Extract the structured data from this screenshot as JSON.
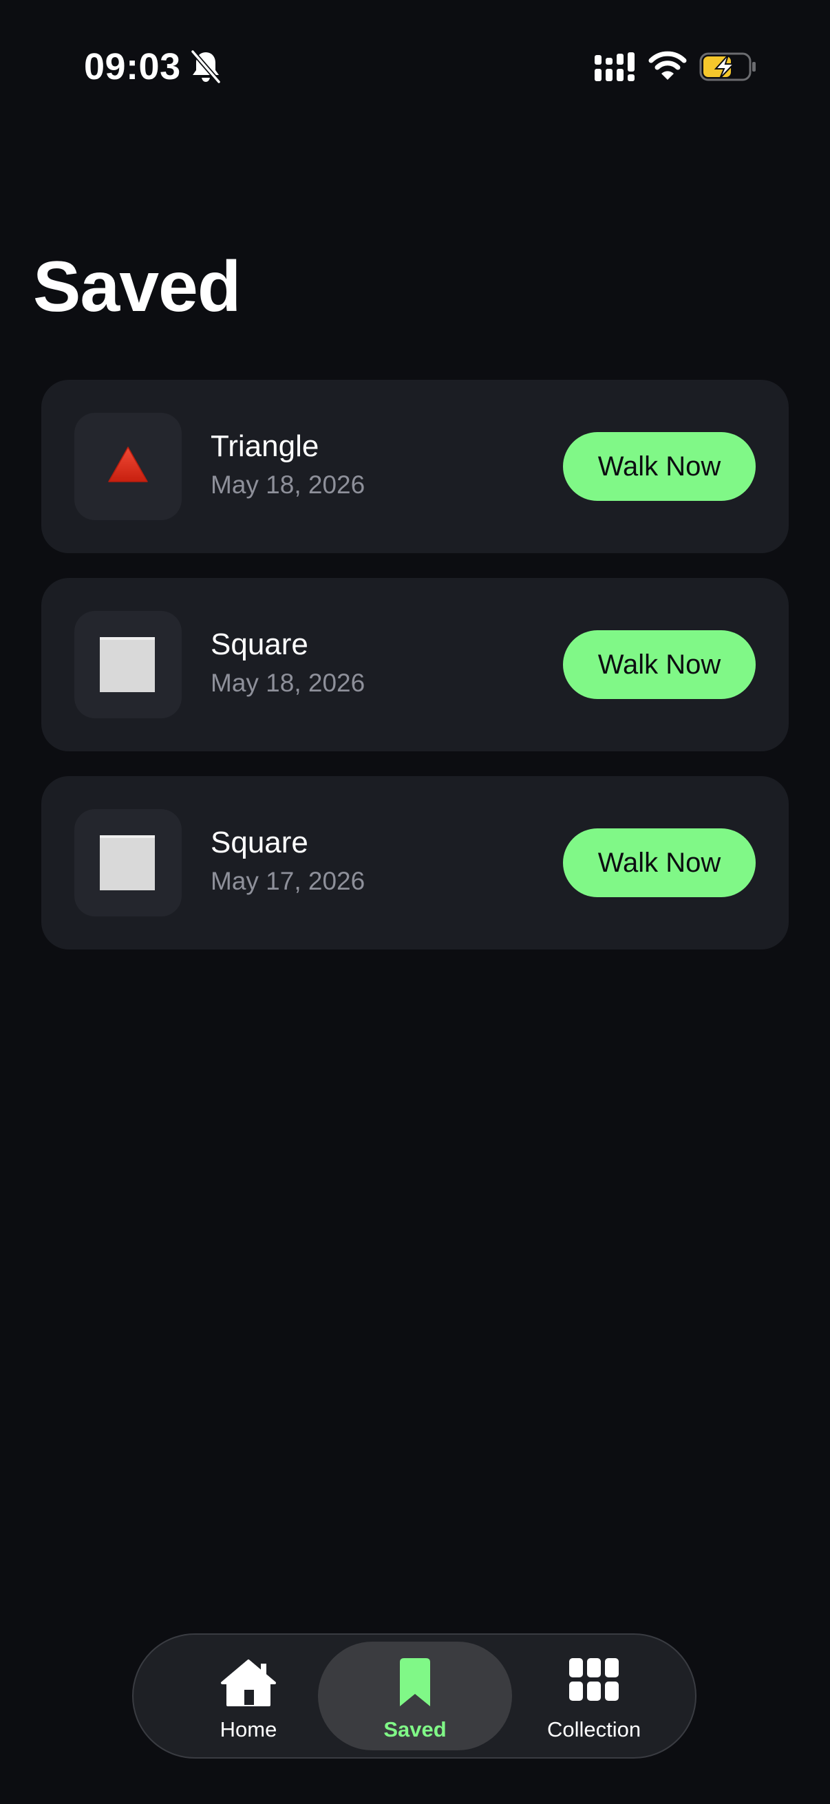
{
  "status_bar": {
    "time": "09:03",
    "icons": [
      "bell-slash-icon",
      "cellular-signal-icon",
      "wifi-icon",
      "battery-charging-icon"
    ]
  },
  "page": {
    "title": "Saved"
  },
  "saved_items": [
    {
      "name": "Triangle",
      "date": "May 18, 2026",
      "icon": "triangle-icon",
      "button_label": "Walk Now"
    },
    {
      "name": "Square",
      "date": "May 18, 2026",
      "icon": "square-icon",
      "button_label": "Walk Now"
    },
    {
      "name": "Square",
      "date": "May 17, 2026",
      "icon": "square-icon",
      "button_label": "Walk Now"
    }
  ],
  "tab_bar": {
    "tabs": [
      {
        "label": "Home",
        "icon": "home-icon",
        "active": false
      },
      {
        "label": "Saved",
        "icon": "bookmark-icon",
        "active": true
      },
      {
        "label": "Collection",
        "icon": "grid-icon",
        "active": false
      }
    ]
  },
  "colors": {
    "background": "#0c0d11",
    "card": "#1b1d23",
    "accent": "#80f887",
    "secondary_text": "#8e909a",
    "triangle": "#e5301c",
    "square": "#d9d9d9",
    "battery_fill": "#f5c72c"
  }
}
